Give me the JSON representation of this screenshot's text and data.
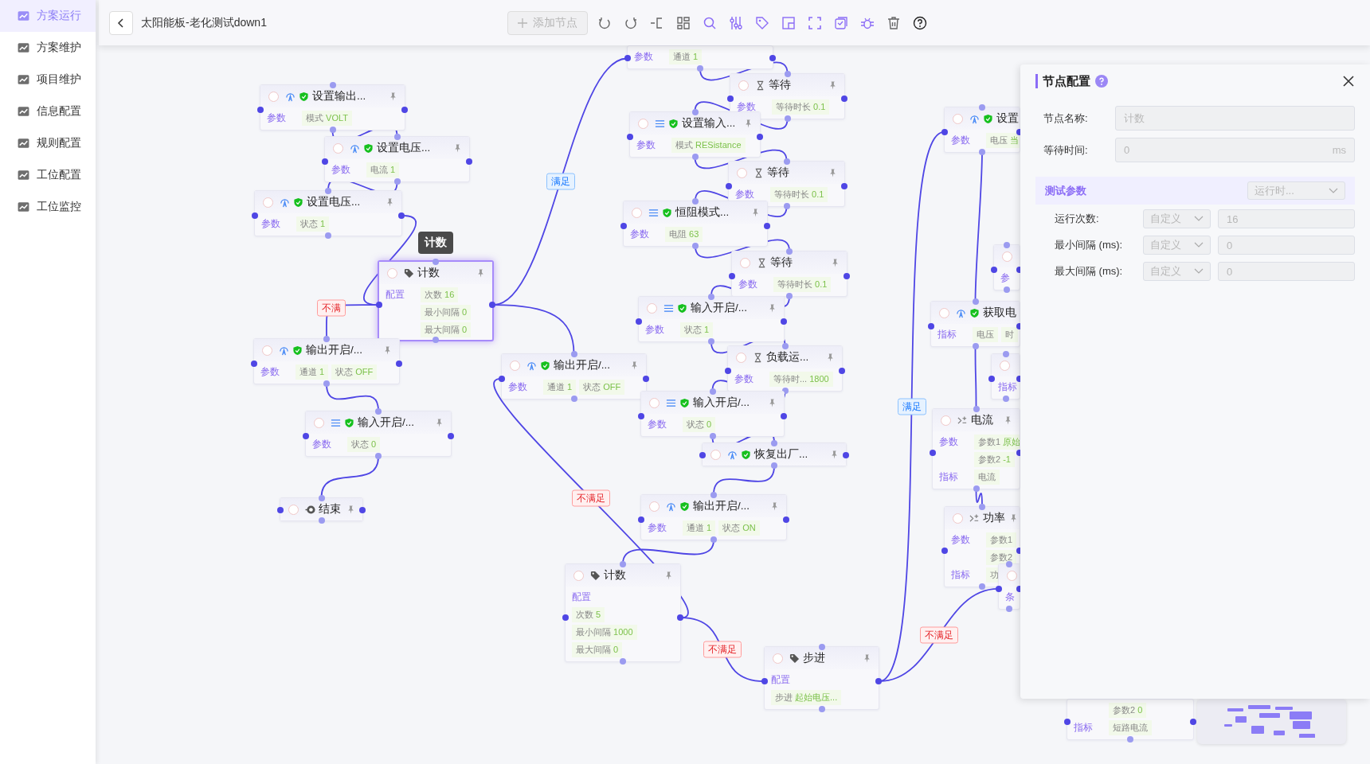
{
  "sidebar": {
    "items": [
      {
        "label": "方案运行",
        "selected": true
      },
      {
        "label": "方案维护",
        "selected": false
      },
      {
        "label": "项目维护",
        "selected": false
      },
      {
        "label": "信息配置",
        "selected": false
      },
      {
        "label": "规则配置",
        "selected": false
      },
      {
        "label": "工位配置",
        "selected": false
      },
      {
        "label": "工位监控",
        "selected": false
      }
    ]
  },
  "toolbar": {
    "title": "太阳能板-老化测试down1",
    "add_button": {
      "label": "添加节点",
      "disabled": true
    }
  },
  "canvas": {
    "tooltip": "计数",
    "nodes": [
      {
        "kind": "signal",
        "title": "设置输出...",
        "selected": false,
        "groups": [
          {
            "label": "参数",
            "chips": [
              {
                "key": "模式",
                "value": "VOLT"
              }
            ]
          }
        ]
      },
      {
        "kind": "signal",
        "title": "设置电压...",
        "selected": false,
        "groups": [
          {
            "label": "参数",
            "chips": [
              {
                "key": "电流",
                "value": "1"
              }
            ]
          }
        ]
      },
      {
        "kind": "signal",
        "title": "设置电压...",
        "selected": false,
        "groups": [
          {
            "label": "参数",
            "chips": [
              {
                "key": "状态",
                "value": "1"
              }
            ]
          }
        ]
      },
      {
        "kind": "tag",
        "title": "计数",
        "selected": true,
        "groups": [
          {
            "label": "配置",
            "chips": [
              {
                "key": "次数",
                "value": "16"
              },
              {
                "key": "最小间隔",
                "value": "0"
              },
              {
                "key": "最大间隔",
                "value": "0"
              }
            ]
          }
        ]
      },
      {
        "kind": "signal",
        "title": "输出开启/...",
        "selected": false,
        "groups": [
          {
            "label": "参数",
            "chips": [
              {
                "key": "通道",
                "value": "1"
              },
              {
                "key": "状态",
                "value": "OFF"
              }
            ]
          }
        ]
      },
      {
        "kind": "list",
        "title": "输入开启/...",
        "selected": false,
        "groups": [
          {
            "label": "参数",
            "chips": [
              {
                "key": "状态",
                "value": "0"
              }
            ]
          }
        ]
      },
      {
        "kind": "end",
        "title": "结束",
        "selected": false
      },
      {
        "selected": false,
        "groups": [
          {
            "label": "参数",
            "chips": [
              {
                "key": "通道",
                "value": "1"
              }
            ]
          }
        ]
      },
      {
        "kind": "hourglass",
        "title": "等待",
        "selected": false,
        "groups": [
          {
            "label": "参数",
            "chips": [
              {
                "key": "等待时长",
                "value": "0.1"
              }
            ]
          }
        ]
      },
      {
        "kind": "list",
        "title": "设置输入...",
        "selected": false,
        "groups": [
          {
            "label": "参数",
            "chips": [
              {
                "key": "模式",
                "value": "RESistance"
              }
            ]
          }
        ]
      },
      {
        "kind": "hourglass",
        "title": "等待",
        "selected": false,
        "groups": [
          {
            "label": "参数",
            "chips": [
              {
                "key": "等待时长",
                "value": "0.1"
              }
            ]
          }
        ]
      },
      {
        "kind": "list",
        "title": "恒阻模式...",
        "selected": false,
        "groups": [
          {
            "label": "参数",
            "chips": [
              {
                "key": "电阻",
                "value": "63"
              }
            ]
          }
        ]
      },
      {
        "kind": "hourglass",
        "title": "等待",
        "selected": false,
        "groups": [
          {
            "label": "参数",
            "chips": [
              {
                "key": "等待时长",
                "value": "0.1"
              }
            ]
          }
        ]
      },
      {
        "kind": "list",
        "title": "输入开启/...",
        "selected": false,
        "groups": [
          {
            "label": "参数",
            "chips": [
              {
                "key": "状态",
                "value": "1"
              }
            ]
          }
        ]
      },
      {
        "kind": "hourglass",
        "title": "负载运...",
        "selected": false,
        "groups": [
          {
            "label": "参数",
            "chips": [
              {
                "key": "等待时...",
                "value": "1800"
              }
            ]
          }
        ]
      },
      {
        "kind": "signal",
        "title": "输出开启/...",
        "selected": false,
        "groups": [
          {
            "label": "参数",
            "chips": [
              {
                "key": "通道",
                "value": "1"
              },
              {
                "key": "状态",
                "value": "OFF"
              }
            ]
          }
        ]
      },
      {
        "kind": "list",
        "title": "输入开启/...",
        "selected": false,
        "groups": [
          {
            "label": "参数",
            "chips": [
              {
                "key": "状态",
                "value": "0"
              }
            ]
          }
        ]
      },
      {
        "kind": "signal",
        "title": "恢复出厂...",
        "selected": false
      },
      {
        "kind": "signal",
        "title": "输出开启/...",
        "selected": false,
        "groups": [
          {
            "label": "参数",
            "chips": [
              {
                "key": "通道",
                "value": "1"
              },
              {
                "key": "状态",
                "value": "ON"
              }
            ]
          }
        ]
      },
      {
        "kind": "tag",
        "title": "计数",
        "selected": false,
        "groups": [
          {
            "label": "配置",
            "chips": [
              {
                "key": "次数",
                "value": "5"
              },
              {
                "key": "最小间隔",
                "value": "1000"
              },
              {
                "key": "最大间隔",
                "value": "0"
              }
            ]
          }
        ]
      },
      {
        "kind": "tag",
        "title": "步进",
        "selected": false,
        "groups": [
          {
            "label": "配置",
            "chips": [
              {
                "key": "步进",
                "value": "起始电压..."
              }
            ]
          }
        ]
      },
      {
        "kind": "signal",
        "title": "设置",
        "selected": false,
        "groups": [
          {
            "label": "参数",
            "chips": [
              {
                "key": "电压",
                "value": "当"
              }
            ]
          }
        ]
      },
      {
        "selected": false,
        "groups": [
          {
            "label": "参"
          }
        ]
      },
      {
        "kind": "signal",
        "title": "获取电",
        "selected": false,
        "groups": [
          {
            "label": "指标",
            "chips": [
              {
                "key": "电压"
              },
              {
                "key": "时"
              }
            ]
          }
        ]
      },
      {
        "selected": false,
        "groups": [
          {
            "label": "指标"
          }
        ]
      },
      {
        "kind": "formula",
        "title": "电流",
        "selected": false,
        "groups": [
          {
            "label": "参数",
            "chips": [
              {
                "key": "参数1",
                "value": "原始"
              },
              {
                "key": "参数2",
                "value": "-1"
              }
            ]
          },
          {
            "label": "指标",
            "chips": [
              {
                "key": "电流"
              }
            ]
          }
        ]
      },
      {
        "kind": "formula",
        "title": "功率",
        "selected": false,
        "groups": [
          {
            "label": "参数",
            "chips": [
              {
                "key": "参数1"
              },
              {
                "key": "参数2"
              }
            ]
          },
          {
            "label": "指标",
            "chips": [
              {
                "key": "功"
              }
            ]
          }
        ]
      },
      {
        "selected": false,
        "groups": [
          {
            "label": "条"
          }
        ]
      },
      {
        "selected": false,
        "groups": [
          {
            "chips": [
              {
                "key": "参数2",
                "value": "0"
              }
            ]
          },
          {
            "label": "指标",
            "chips": [
              {
                "key": "短路电流"
              }
            ]
          }
        ]
      }
    ],
    "edge_labels": [
      {
        "text": "满足",
        "kind": "yes"
      },
      {
        "text": "不满",
        "kind": "no"
      },
      {
        "text": "满足",
        "kind": "yes"
      },
      {
        "text": "不满足",
        "kind": "no"
      },
      {
        "text": "不满足",
        "kind": "no"
      },
      {
        "text": "不满足",
        "kind": "no"
      }
    ]
  },
  "panel": {
    "title": "节点配置",
    "fields": [
      {
        "label": "节点名称:",
        "value": "计数",
        "disabled": true
      },
      {
        "label": "等待时间:",
        "value": "0",
        "suffix": "ms",
        "disabled": true
      }
    ],
    "section": {
      "title": "测试参数",
      "select": "运行时..."
    },
    "rows": [
      {
        "label": "运行次数:",
        "mode": "自定义",
        "value": "16"
      },
      {
        "label": "最小间隔 (ms):",
        "mode": "自定义",
        "value": "0"
      },
      {
        "label": "最大间隔 (ms):",
        "mode": "自定义",
        "value": "0"
      }
    ]
  }
}
